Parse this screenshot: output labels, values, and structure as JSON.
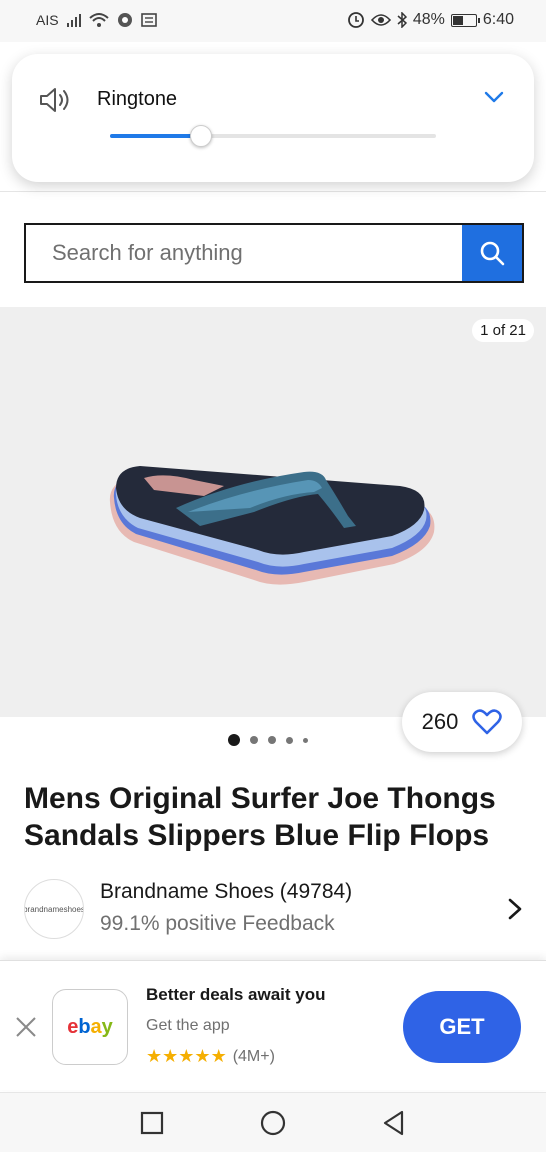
{
  "status_bar": {
    "carrier": "AIS",
    "battery": "48%",
    "battery_level": 0.48,
    "time": "6:40"
  },
  "volume_panel": {
    "label": "Ringtone",
    "level": 0.28,
    "accent_color": "#1f7ae8"
  },
  "search": {
    "placeholder": "Search for anything",
    "button_color": "#1f6fe0"
  },
  "gallery": {
    "counter": "1 of 21",
    "dots_count": 5,
    "active_dot": 0
  },
  "watch": {
    "count": "260",
    "icon": "heart-icon"
  },
  "product": {
    "title": "Mens Original Surfer Joe Thongs Sandals Slippers Blue Flip Flops"
  },
  "seller": {
    "name": "Brandname Shoes (49784)",
    "feedback": "99.1% positive Feedback",
    "logo_text": "brandnameshoes"
  },
  "app_banner": {
    "logo_text": "ebay",
    "title": "Better deals await you",
    "subtitle": "Get the app",
    "stars": 5,
    "rating_count": "(4M+)",
    "button_label": "GET",
    "button_color": "#2f63e6",
    "star_color": "#f5af02"
  },
  "nav_bar": {
    "buttons": [
      "recent-apps-icon",
      "home-icon",
      "back-icon"
    ]
  }
}
